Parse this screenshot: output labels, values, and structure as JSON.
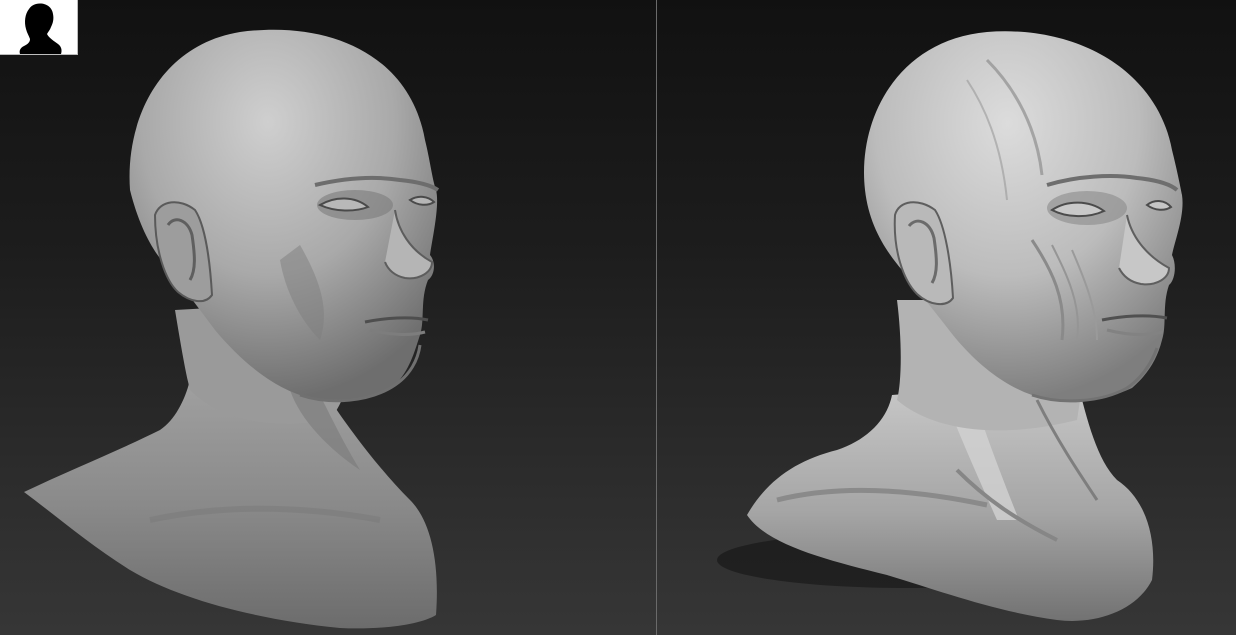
{
  "viewports": {
    "left": {
      "name": "sculpt-viewport-left"
    },
    "right": {
      "name": "sculpt-viewport-right"
    }
  },
  "preview_thumbnail": {
    "icon": "head-silhouette-icon"
  },
  "colors": {
    "viewport_bg_top": "#111111",
    "viewport_bg_bottom": "#363636",
    "clay_light": "#c9c9c9",
    "clay_mid": "#8e8e8e",
    "clay_dark": "#3f3f3f",
    "divider": "#6a6a6a"
  }
}
